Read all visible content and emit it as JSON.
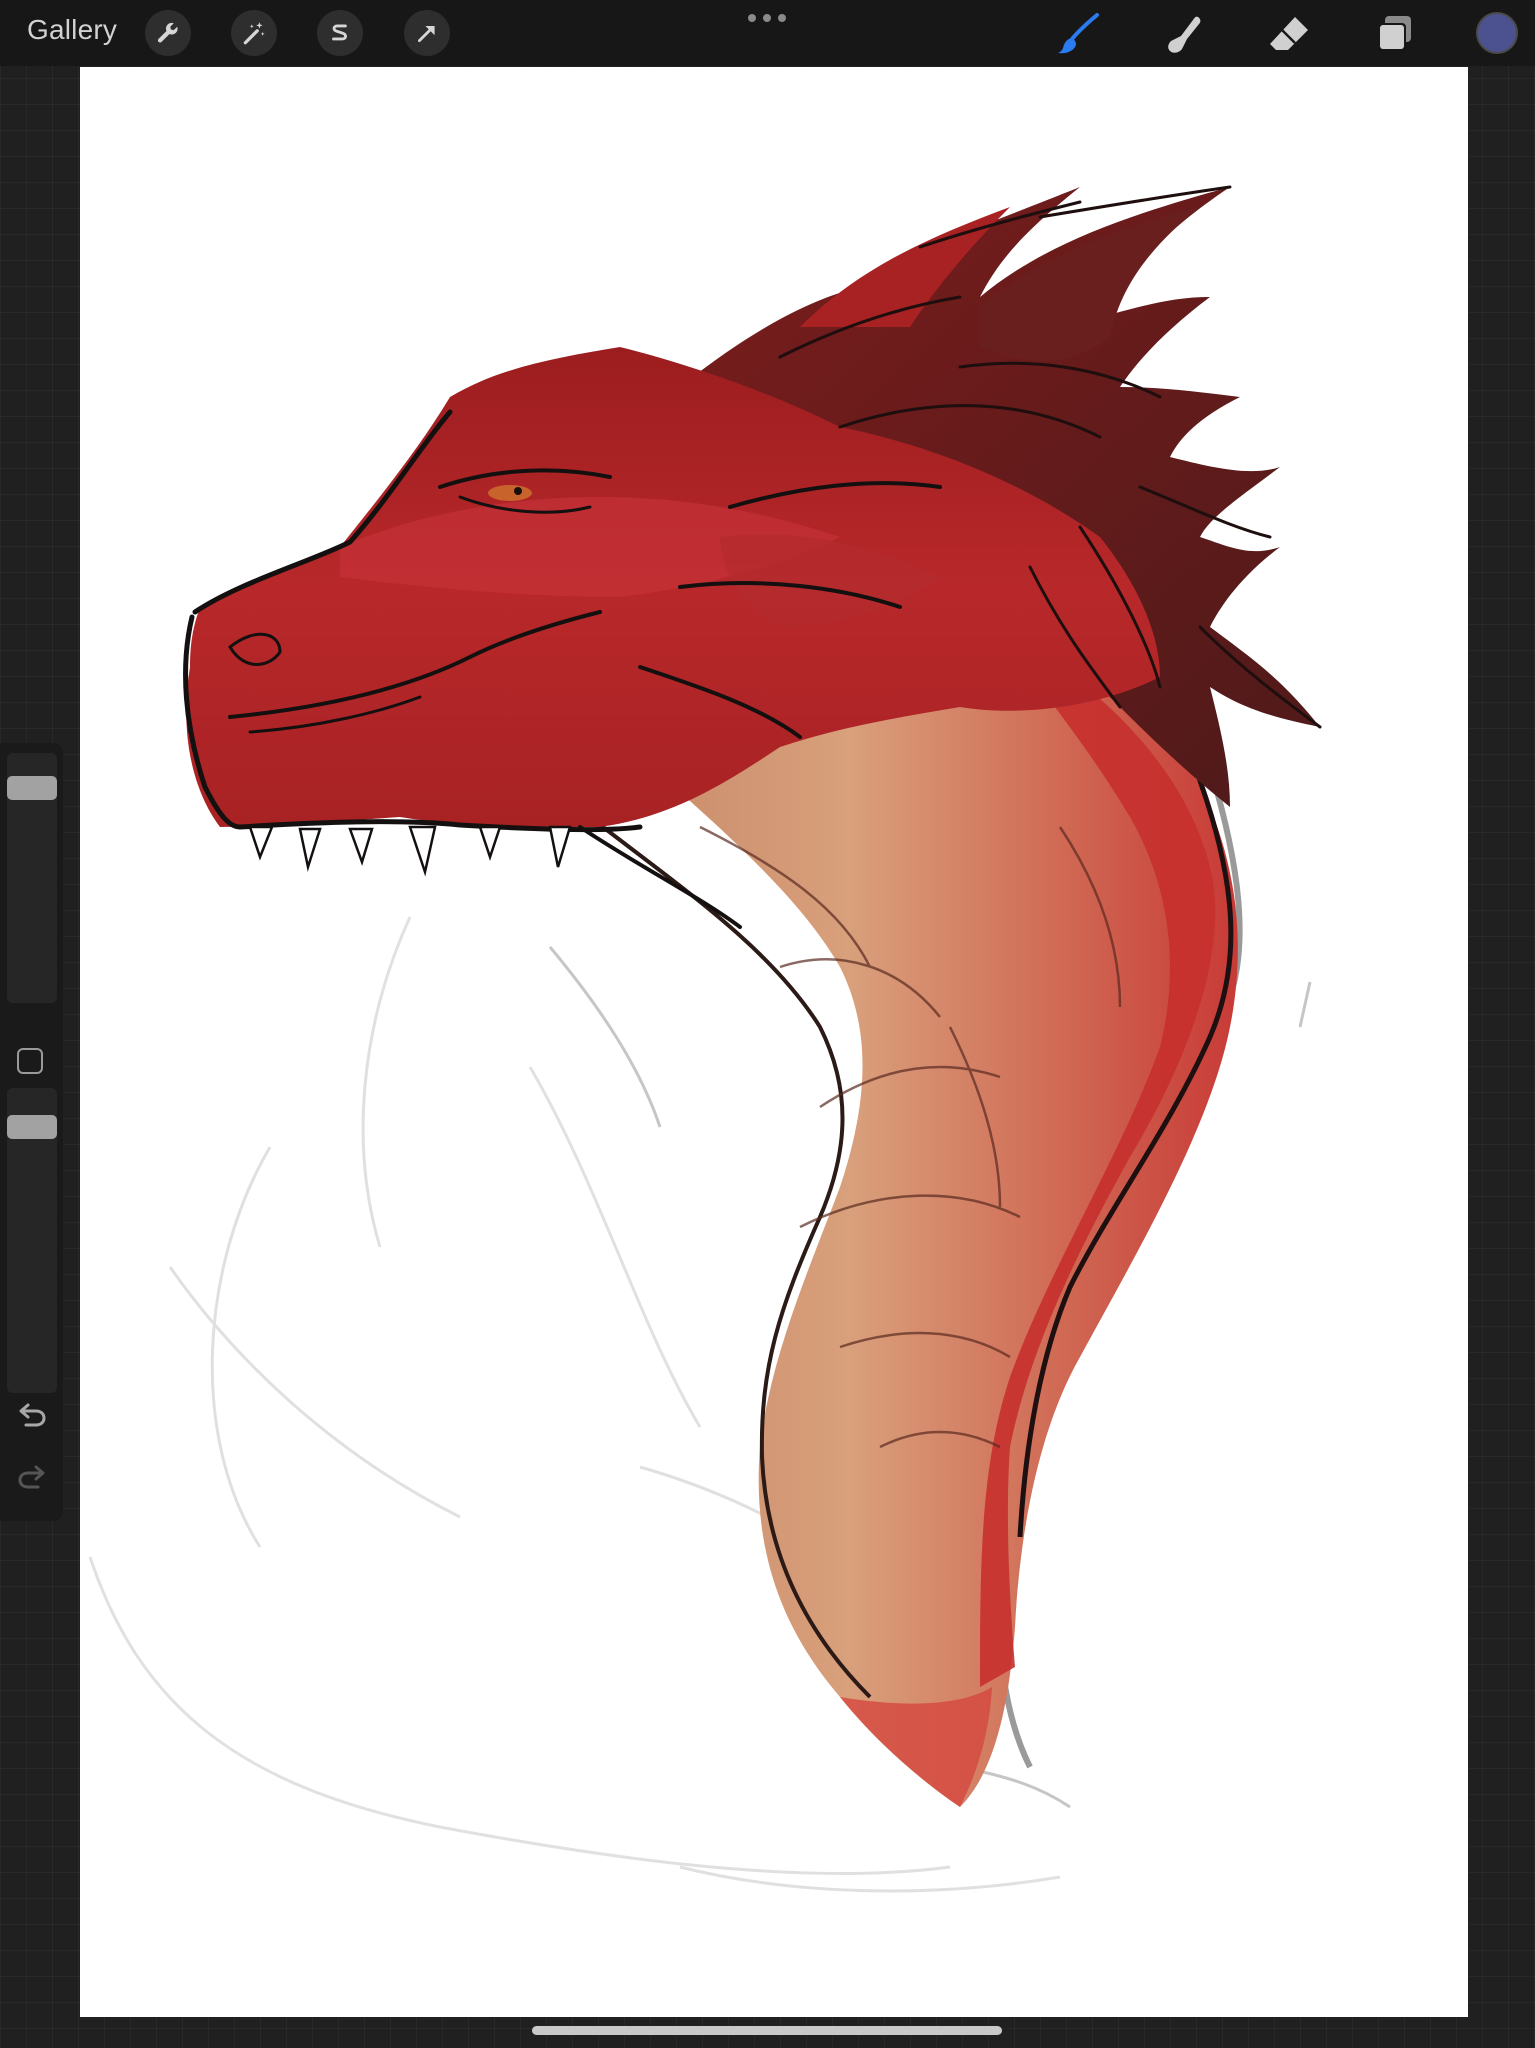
{
  "topbar": {
    "gallery_label": "Gallery",
    "left_tools": [
      {
        "name": "actions",
        "icon": "wrench-icon"
      },
      {
        "name": "adjustments",
        "icon": "magic-wand-icon"
      },
      {
        "name": "selection",
        "icon": "selection-s-icon"
      },
      {
        "name": "transform",
        "icon": "arrow-cursor-icon"
      }
    ],
    "more_icon": "more-dots-icon",
    "right_tools": [
      {
        "name": "brush",
        "icon": "brush-icon",
        "active": true
      },
      {
        "name": "smudge",
        "icon": "smudge-finger-icon",
        "active": false
      },
      {
        "name": "eraser",
        "icon": "eraser-icon",
        "active": false
      },
      {
        "name": "layers",
        "icon": "layers-icon",
        "active": false
      }
    ],
    "current_color": "#4c5290"
  },
  "colors": {
    "active_tool": "#2a7bf0",
    "toolbar_bg": "#171717",
    "canvas_bg": "#ffffff",
    "workspace_bg": "#202020"
  },
  "sidebar": {
    "brush_size_level": 0.93,
    "brush_opacity_level": 0.93,
    "modify_icon": "square-modify-icon",
    "undo_icon": "undo-arrow-icon",
    "redo_icon": "redo-arrow-icon",
    "redo_enabled": false
  },
  "canvas": {
    "artwork": "red-dragon-head-sketch"
  }
}
